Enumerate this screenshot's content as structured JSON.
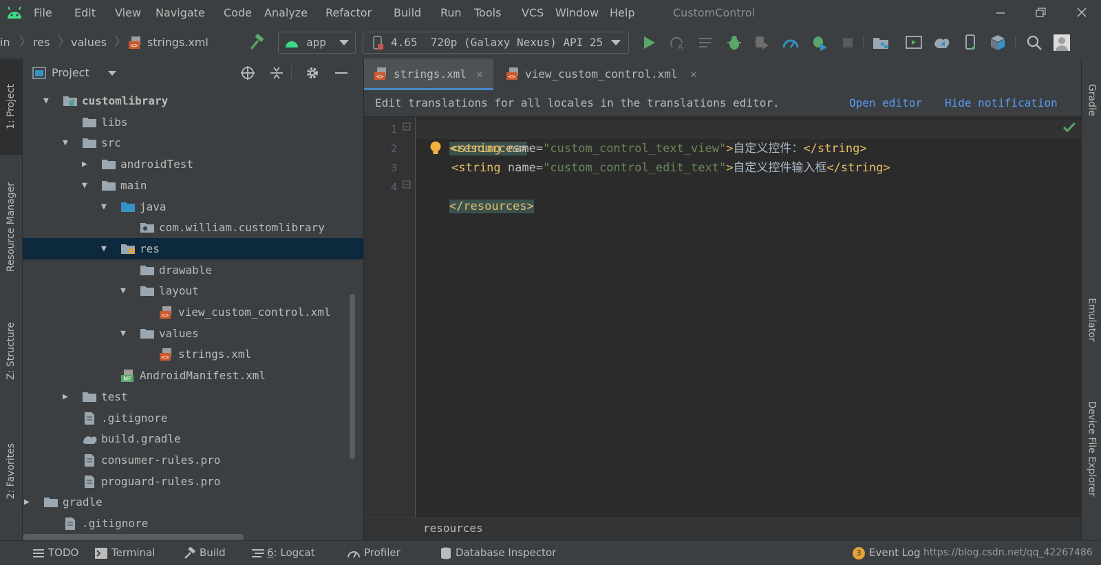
{
  "menu": [
    "File",
    "Edit",
    "View",
    "Navigate",
    "Code",
    "Analyze",
    "Refactor",
    "Build",
    "Run",
    "Tools",
    "VCS",
    "Window",
    "Help"
  ],
  "window": {
    "title": "CustomControl"
  },
  "breadcrumb": [
    "in",
    "res",
    "values",
    "strings.xml"
  ],
  "toolbar": {
    "run_config": "app",
    "device": "4.65  720p (Galaxy Nexus) API 25"
  },
  "left_strip": {
    "project": "1: Project",
    "resource_manager": "Resource Manager",
    "structure": "Z: Structure",
    "favorites": "2: Favorites"
  },
  "right_strip": {
    "gradle": "Gradle",
    "emulator": "Emulator",
    "device_explorer": "Device File Explorer"
  },
  "project_panel": {
    "title": "Project",
    "tree": [
      {
        "label": "customlibrary",
        "bold": true,
        "arrow": "down",
        "icon": "module-folder-icon"
      },
      {
        "label": "libs",
        "arrow": "",
        "icon": "folder-icon"
      },
      {
        "label": "src",
        "arrow": "down",
        "icon": "folder-icon"
      },
      {
        "label": "androidTest",
        "arrow": "right",
        "icon": "folder-icon"
      },
      {
        "label": "main",
        "arrow": "down",
        "icon": "folder-icon"
      },
      {
        "label": "java",
        "arrow": "down",
        "icon": "source-folder-icon"
      },
      {
        "label": "com.william.customlibrary",
        "arrow": "",
        "icon": "package-icon"
      },
      {
        "label": "res",
        "arrow": "down",
        "icon": "res-folder-icon",
        "selected": true
      },
      {
        "label": "drawable",
        "arrow": "",
        "icon": "folder-icon"
      },
      {
        "label": "layout",
        "arrow": "down",
        "icon": "folder-icon"
      },
      {
        "label": "view_custom_control.xml",
        "arrow": "",
        "icon": "xml-file-icon"
      },
      {
        "label": "values",
        "arrow": "down",
        "icon": "folder-icon"
      },
      {
        "label": "strings.xml",
        "arrow": "",
        "icon": "xml-file-icon"
      },
      {
        "label": "AndroidManifest.xml",
        "arrow": "",
        "icon": "manifest-file-icon"
      },
      {
        "label": "test",
        "arrow": "right",
        "icon": "folder-icon"
      },
      {
        "label": ".gitignore",
        "arrow": "",
        "icon": "text-file-icon"
      },
      {
        "label": "build.gradle",
        "arrow": "",
        "icon": "gradle-file-icon"
      },
      {
        "label": "consumer-rules.pro",
        "arrow": "",
        "icon": "text-file-icon"
      },
      {
        "label": "proguard-rules.pro",
        "arrow": "",
        "icon": "text-file-icon"
      },
      {
        "label": "gradle",
        "arrow": "right",
        "icon": "folder-icon"
      },
      {
        "label": ".gitignore",
        "arrow": "",
        "icon": "text-file-icon"
      }
    ]
  },
  "editor": {
    "tabs": [
      {
        "label": "strings.xml",
        "active": true
      },
      {
        "label": "view_custom_control.xml",
        "active": false
      }
    ],
    "notification": {
      "text": "Edit translations for all locales in the translations editor.",
      "open": "Open editor",
      "hide": "Hide notification"
    },
    "line_numbers": [
      "1",
      "2",
      "3",
      "4"
    ],
    "code": {
      "l1": "<resources>",
      "l2_open": "<string ",
      "l2_attr": "name=",
      "l2_val": "\"custom_control_text_view\"",
      "l2_gt": ">",
      "l2_text": "自定义控件：",
      "l2_close": "</string>",
      "l3_open": "<string ",
      "l3_attr": "name=",
      "l3_val": "\"custom_control_edit_text\"",
      "l3_gt": ">",
      "l3_text": "自定义控件输入框",
      "l3_close": "</string>",
      "l4": "</resources>"
    },
    "breadcrumb": "resources"
  },
  "statusbar": {
    "todo": "TODO",
    "terminal": "Terminal",
    "build": "Build",
    "logcat_num": "6",
    "logcat": ": Logcat",
    "profiler": "Profiler",
    "db": "Database Inspector",
    "event_count": "3",
    "event_log": "Event Log",
    "watermark": "https://blog.csdn.net/qq_42267486"
  }
}
